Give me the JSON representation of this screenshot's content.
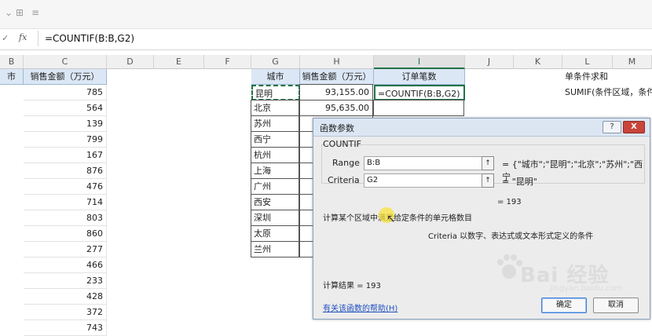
{
  "toolbar": {
    "buttons": [
      {
        "icon": "dropdown-arrow-icon",
        "glyph": "⌄"
      },
      {
        "icon": "borders-icon",
        "glyph": "⊞"
      },
      {
        "icon": "format-icon",
        "glyph": "≡"
      }
    ]
  },
  "formula_bar": {
    "cancel_glyph": "✓",
    "fx_label": "fx",
    "formula": "=COUNTIF(B:B,G2)"
  },
  "columns": [
    "B",
    "C",
    "D",
    "E",
    "F",
    "G",
    "H",
    "I",
    "J",
    "K",
    "L",
    "M"
  ],
  "left_table": {
    "header_b": "市",
    "header_c": "销售金额（万元）",
    "values": [
      "785",
      "564",
      "139",
      "799",
      "167",
      "876",
      "476",
      "714",
      "803",
      "860",
      "277",
      "466",
      "233",
      "428",
      "372",
      "743"
    ]
  },
  "right_table": {
    "header_city": "城市",
    "header_sales": "销售金额（万元）",
    "header_orders": "订单笔数",
    "cities": [
      "昆明",
      "北京",
      "苏州",
      "西宁",
      "杭州",
      "上海",
      "广州",
      "西安",
      "深圳",
      "太原",
      "兰州"
    ],
    "sales": [
      "93,155.00",
      "95,635.00"
    ],
    "editing_formula": "=COUNTIF(B:B,G2)"
  },
  "notes": {
    "l1": "单条件求和",
    "l2": "SUMIF(条件区域，条件"
  },
  "dialog": {
    "title": "函数参数",
    "help_glyph": "?",
    "close_glyph": "X",
    "function_name": "COUNTIF",
    "args": [
      {
        "label": "Range",
        "value": "B:B",
        "result": "= {\"城市\";\"昆明\";\"北京\";\"苏州\";\"西宁"
      },
      {
        "label": "Criteria",
        "value": "G2",
        "result": "= \"昆明\""
      }
    ],
    "result_line": "= 193",
    "description": "计算某个区域中满足给定条件的单元格数目",
    "arg_description": "Criteria  以数字、表达式或文本形式定义的条件",
    "calc_result": "计算结果 =   193",
    "help_link": "有关该函数的帮助(H)",
    "ok_label": "确定",
    "cancel_label": "取消"
  },
  "watermark": {
    "brand": "Bai 经验",
    "url": "jingyan.baidu.com"
  }
}
